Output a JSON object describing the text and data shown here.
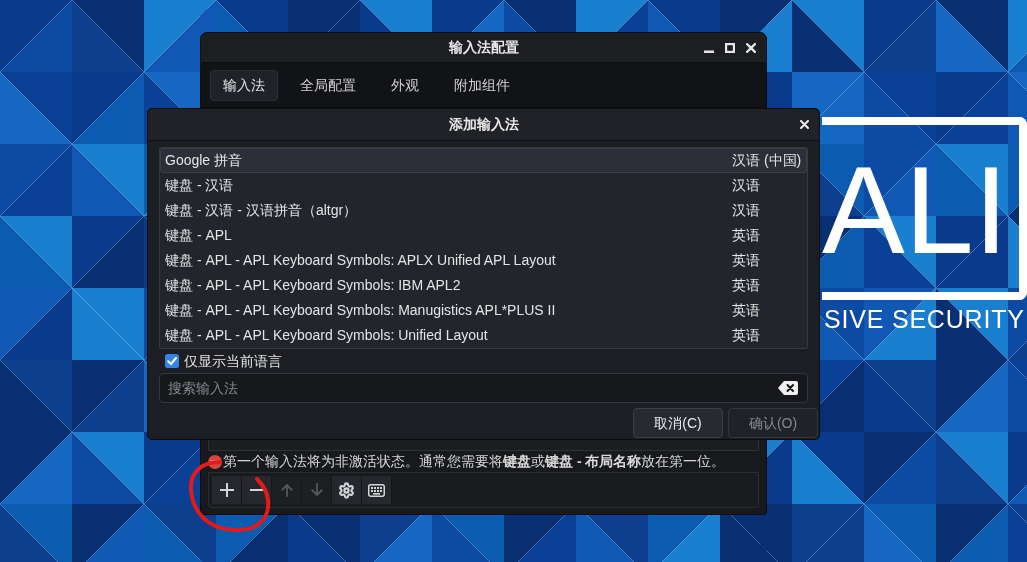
{
  "config_window": {
    "title": "输入法配置",
    "tabs": [
      {
        "label": "输入法",
        "selected": true
      },
      {
        "label": "全局配置",
        "selected": false
      },
      {
        "label": "外观",
        "selected": false
      },
      {
        "label": "附加组件",
        "selected": false
      }
    ],
    "note": "第一个输入法将为非激活状态。通常您需要将**键盘**或**键盘 - 布局名称**放在第一位。",
    "toolbar": [
      {
        "kind": "add",
        "disabled": false
      },
      {
        "kind": "remove",
        "disabled": false
      },
      {
        "kind": "move_up",
        "disabled": true
      },
      {
        "kind": "move_down",
        "disabled": true
      },
      {
        "kind": "configure",
        "disabled": false
      },
      {
        "kind": "keyboard_layout",
        "disabled": false
      }
    ]
  },
  "dialog": {
    "title": "添加输入法",
    "rows": [
      {
        "name": "Google 拼音",
        "language": "汉语 (中国)",
        "selected": true
      },
      {
        "name": "键盘 - 汉语",
        "language": "汉语",
        "selected": false
      },
      {
        "name": "键盘 - 汉语 - 汉语拼音（altgr）",
        "language": "汉语",
        "selected": false
      },
      {
        "name": "键盘 - APL",
        "language": "英语",
        "selected": false
      },
      {
        "name": "键盘 - APL - APL Keyboard Symbols: APLX Unified APL Layout",
        "language": "英语",
        "selected": false
      },
      {
        "name": "键盘 - APL - APL Keyboard Symbols: IBM APL2",
        "language": "英语",
        "selected": false
      },
      {
        "name": "键盘 - APL - APL Keyboard Symbols: Manugistics APL*PLUS II",
        "language": "英语",
        "selected": false
      },
      {
        "name": "键盘 - APL - APL Keyboard Symbols: Unified Layout",
        "language": "英语",
        "selected": false
      }
    ],
    "filter": {
      "label": "仅显示当前语言",
      "checked": true
    },
    "search": {
      "placeholder": "搜索输入法"
    },
    "buttons": [
      {
        "label": "取消(C)",
        "disabled": false
      },
      {
        "label": "确认(O)",
        "disabled": true
      }
    ]
  },
  "wallpaper": {
    "logo_text": "ALI",
    "tagline": "SIVE SECURITY"
  }
}
